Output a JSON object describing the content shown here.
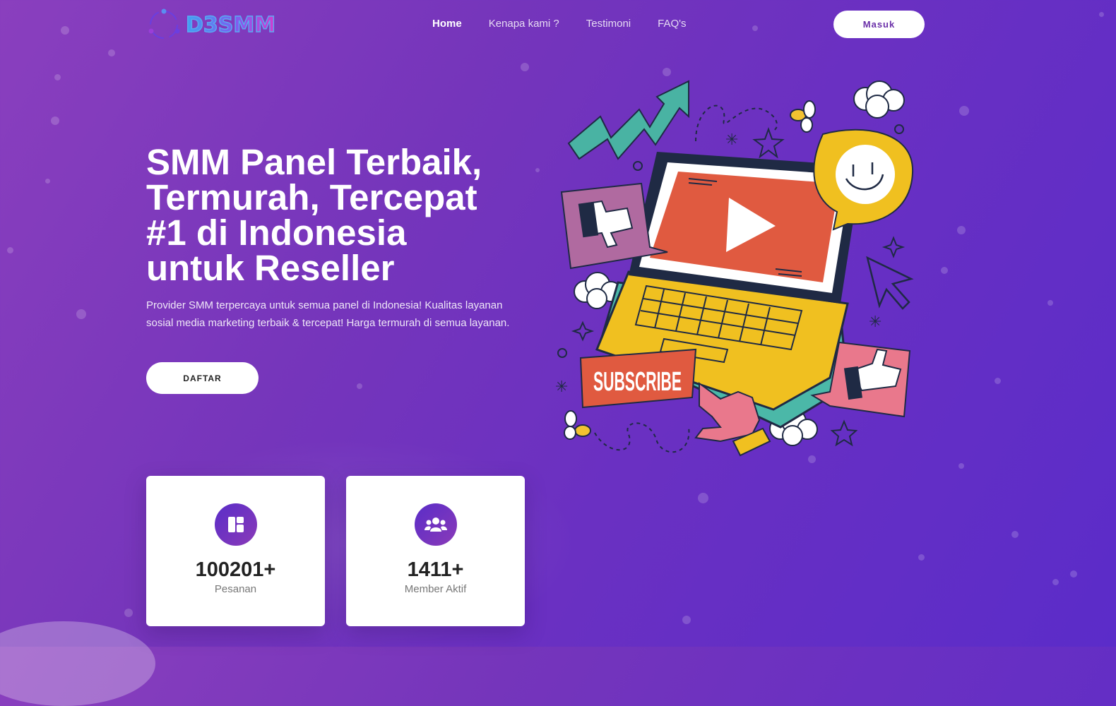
{
  "header": {
    "logo_text": "D3SMM",
    "nav": [
      {
        "label": "Home",
        "active": true
      },
      {
        "label": "Kenapa kami ?"
      },
      {
        "label": "Testimoni"
      },
      {
        "label": "FAQ's"
      }
    ],
    "login_label": "Masuk"
  },
  "hero": {
    "title_lines": [
      "SMM Panel Terbaik,",
      "Termurah, Tercepat",
      "#1 di Indonesia",
      "untuk Reseller"
    ],
    "description": "Provider SMM terpercaya untuk semua panel di Indonesia! Kualitas layanan sosial media marketing terbaik & tercepat! Harga termurah di semua layanan.",
    "register_label": "DAFTAR"
  },
  "stats": [
    {
      "icon": "dashboard-icon",
      "value": "100201+",
      "label": "Pesanan"
    },
    {
      "icon": "users-icon",
      "value": "1411+",
      "label": "Member Aktif"
    }
  ],
  "illustration": {
    "subscribe_text": "SUBSCRIBE"
  },
  "colors": {
    "bg_start": "#8a3fbe",
    "bg_end": "#5b2cc9",
    "accent": "#6a2fa8"
  }
}
